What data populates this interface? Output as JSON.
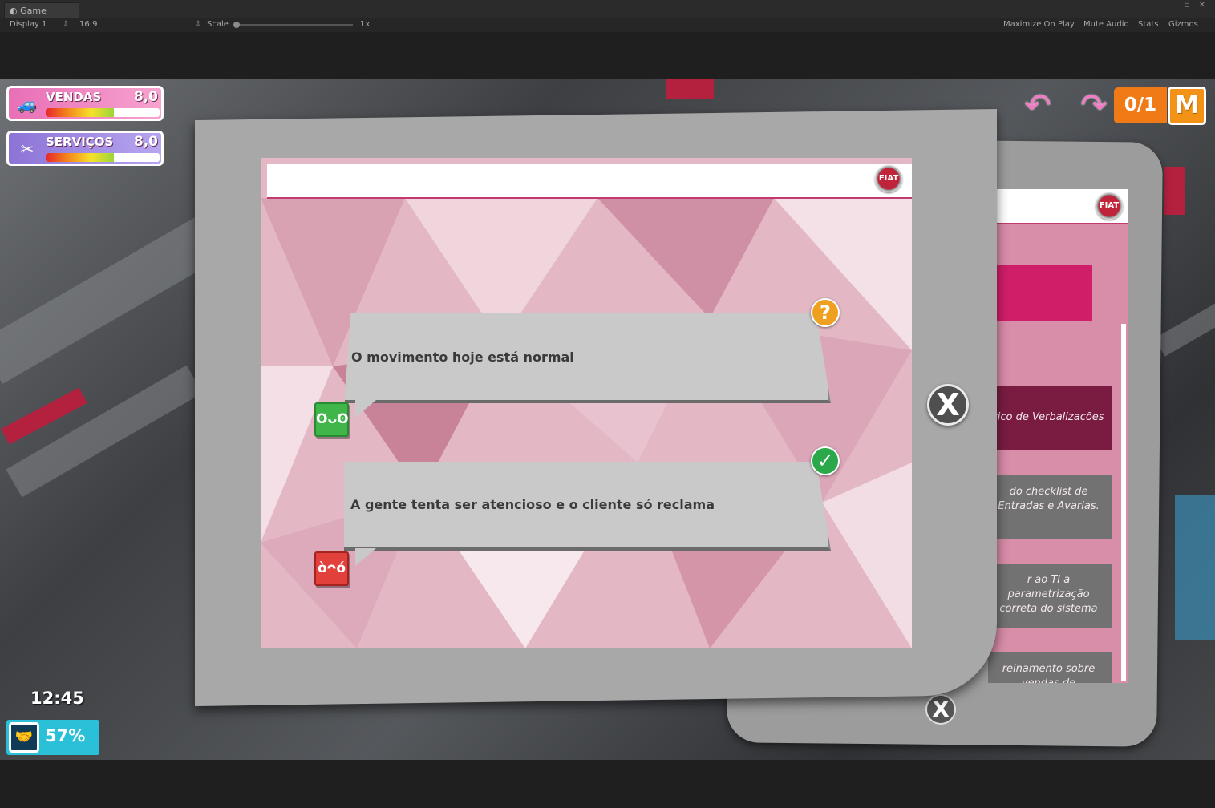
{
  "editor": {
    "tab_title": "Game",
    "display": "Display 1",
    "aspect": "16:9",
    "scale_label": "Scale",
    "scale_value": "1x",
    "maximize_on_play": "Maximize On Play",
    "mute_audio": "Mute Audio",
    "stats": "Stats",
    "gizmos": "Gizmos"
  },
  "hud": {
    "vendas": {
      "label": "VENDAS",
      "value": "8,0",
      "level": 0.6
    },
    "servicos": {
      "label": "SERVIÇOS",
      "value": "8,0",
      "level": 0.6
    },
    "clock": "12:45",
    "satisfaction": "57%",
    "mission_counter": "0/1",
    "mission_button": "M"
  },
  "dialog": {
    "bubbles": [
      {
        "text": "O movimento hoje está normal",
        "badge_icon": "question-icon",
        "speaker_face": "happy-face-icon"
      },
      {
        "text": "A gente tenta ser atencioso e o cliente só reclama",
        "badge_icon": "check-icon",
        "speaker_face": "angry-face-icon"
      }
    ],
    "close_label": "X",
    "logo_text": "FIAT"
  },
  "back_tablet": {
    "items": [
      "rico de Verbalizações",
      "do checklist de Entradas e Avarias.",
      "r ao TI a parametrização correta do sistema",
      "reinamento sobre vendas de"
    ],
    "logo_text": "FIAT",
    "close_label": "X"
  },
  "colors": {
    "accent_pink": "#d11e69",
    "vendas_bar": "#e86fb6",
    "servicos_bar": "#8c73d6",
    "mission_orange": "#f07a16",
    "mood_cyan": "#29c0d8"
  }
}
